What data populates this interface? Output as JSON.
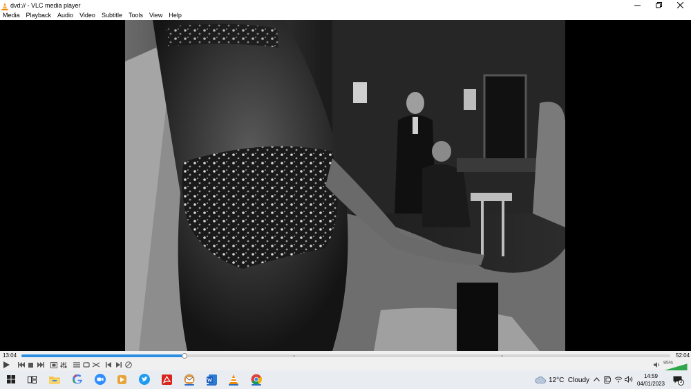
{
  "window": {
    "title": "dvd:// - VLC media player"
  },
  "menu": {
    "items": [
      "Media",
      "Playback",
      "Audio",
      "Video",
      "Subtitle",
      "Tools",
      "View",
      "Help"
    ]
  },
  "player": {
    "elapsed": "13:04",
    "duration": "52:04",
    "progress_fraction": 0.251,
    "volume": "95%",
    "volume_fraction": 0.95
  },
  "controls": {
    "icons": [
      "play-icon",
      "previous-icon",
      "stop-icon",
      "next-icon",
      "fullscreen-icon",
      "extended-settings-icon",
      "playlist-icon",
      "loop-icon",
      "shuffle-icon",
      "frame-back-icon",
      "frame-forward-icon",
      "record-icon"
    ]
  },
  "taskbar": {
    "apps": [
      "start-icon",
      "task-view-icon",
      "file-explorer-icon",
      "google-icon",
      "zoom-icon",
      "media-icon",
      "twitter-icon",
      "acrobat-icon",
      "mail-icon",
      "word-icon",
      "vlc-icon",
      "chrome-icon"
    ],
    "weather": {
      "temp": "12°C",
      "condition": "Cloudy"
    },
    "clock": {
      "time": "14:59",
      "date": "04/01/2023"
    },
    "notifications": "3"
  },
  "colors": {
    "accent": "#2b8ee0",
    "vlc_orange": "#f08a00",
    "taskbar": "#e9ecf1"
  }
}
